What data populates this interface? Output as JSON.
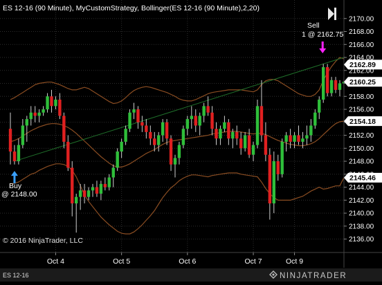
{
  "header": {
    "title": "ES 12-16 (90 Minute), MyCustomStrategy, Bollinger(ES 12-16 (90 Minute),2,20)"
  },
  "copyright": "© 2016 NinjaTrader, LLC",
  "status_bar": {
    "instrument_tab": "ES 12-16",
    "logo_text": "NINJATRADER"
  },
  "annotations": {
    "buy_line1": "Buy",
    "buy_line2": "@ 2148.00",
    "sell_line1": "Sell",
    "sell_line2": "1 @ 2162.75"
  },
  "colors": {
    "background": "#000000",
    "grid": "#2e2e2e",
    "axis_text": "#ffffff",
    "up_candle": "#2fbf3a",
    "down_candle": "#e02020",
    "wick": "#cfcfcf",
    "bollinger_band": "#8b4d22",
    "trendline": "#1f6f2a",
    "buy_arrow": "#3aa0ff",
    "sell_arrow": "#ff22ff",
    "price_label_bg": "#ffffff",
    "price_label_text": "#000000"
  },
  "icons": {
    "scroll_end": "play-to-end-icon"
  },
  "chart_data": {
    "type": "candlestick",
    "x_tick_labels": [
      "Oct 4",
      "Oct 5",
      "Oct 6",
      "Oct 7",
      "Oct 9"
    ],
    "x_tick_bar_index": [
      11,
      27,
      43,
      59,
      69
    ],
    "ylim": [
      2135.0,
      2172.0
    ],
    "y_ticks": [
      2136,
      2138,
      2140,
      2142,
      2144,
      2146,
      2148,
      2150,
      2152,
      2154,
      2156,
      2158,
      2160,
      2162,
      2164,
      2166,
      2168,
      2170
    ],
    "y_tick_labels": [
      "2136.00",
      "2138.00",
      "2140.00",
      "2142.00",
      "2144.00",
      "2146.00",
      "2148.00",
      "2150.00",
      "2152.00",
      "2154.00",
      "2156.00",
      "2158.00",
      "2160.00",
      "2162.00",
      "2164.00",
      "2166.00",
      "2168.00",
      "2170.00"
    ],
    "price_labels": [
      {
        "value": 2162.89,
        "text": "2162.89"
      },
      {
        "value": 2160.25,
        "text": "2160.25"
      },
      {
        "value": 2154.18,
        "text": "2154.18"
      },
      {
        "value": 2145.46,
        "text": "2145.46"
      }
    ],
    "candles": [
      {
        "o": 2153.0,
        "h": 2155.5,
        "l": 2147.5,
        "c": 2149.5
      },
      {
        "o": 2149.5,
        "h": 2150.5,
        "l": 2147.5,
        "c": 2148.0
      },
      {
        "o": 2148.0,
        "h": 2151.5,
        "l": 2147.5,
        "c": 2150.5
      },
      {
        "o": 2150.5,
        "h": 2154.5,
        "l": 2150.0,
        "c": 2153.5
      },
      {
        "o": 2153.5,
        "h": 2155.0,
        "l": 2151.0,
        "c": 2154.5
      },
      {
        "o": 2154.5,
        "h": 2156.5,
        "l": 2153.5,
        "c": 2155.5
      },
      {
        "o": 2155.5,
        "h": 2156.5,
        "l": 2154.0,
        "c": 2155.0
      },
      {
        "o": 2155.0,
        "h": 2156.0,
        "l": 2154.0,
        "c": 2155.5
      },
      {
        "o": 2155.5,
        "h": 2156.5,
        "l": 2155.0,
        "c": 2156.0
      },
      {
        "o": 2156.0,
        "h": 2158.5,
        "l": 2155.5,
        "c": 2158.0
      },
      {
        "o": 2158.0,
        "h": 2159.0,
        "l": 2155.5,
        "c": 2156.5
      },
      {
        "o": 2156.5,
        "h": 2158.0,
        "l": 2156.0,
        "c": 2157.5
      },
      {
        "o": 2157.5,
        "h": 2158.5,
        "l": 2154.5,
        "c": 2155.0
      },
      {
        "o": 2155.0,
        "h": 2155.5,
        "l": 2150.0,
        "c": 2151.0
      },
      {
        "o": 2151.0,
        "h": 2152.0,
        "l": 2146.5,
        "c": 2147.0
      },
      {
        "o": 2147.0,
        "h": 2148.0,
        "l": 2139.5,
        "c": 2141.5
      },
      {
        "o": 2141.5,
        "h": 2143.0,
        "l": 2137.0,
        "c": 2142.5
      },
      {
        "o": 2142.5,
        "h": 2144.5,
        "l": 2140.5,
        "c": 2143.5
      },
      {
        "o": 2143.5,
        "h": 2144.5,
        "l": 2141.5,
        "c": 2142.5
      },
      {
        "o": 2142.5,
        "h": 2144.0,
        "l": 2142.0,
        "c": 2143.5
      },
      {
        "o": 2143.5,
        "h": 2144.5,
        "l": 2142.5,
        "c": 2144.0
      },
      {
        "o": 2144.0,
        "h": 2145.0,
        "l": 2142.5,
        "c": 2143.0
      },
      {
        "o": 2143.0,
        "h": 2145.0,
        "l": 2142.0,
        "c": 2144.5
      },
      {
        "o": 2144.5,
        "h": 2145.5,
        "l": 2143.5,
        "c": 2144.0
      },
      {
        "o": 2144.0,
        "h": 2146.0,
        "l": 2143.5,
        "c": 2145.5
      },
      {
        "o": 2145.5,
        "h": 2147.5,
        "l": 2144.0,
        "c": 2147.0
      },
      {
        "o": 2147.0,
        "h": 2150.0,
        "l": 2146.5,
        "c": 2149.5
      },
      {
        "o": 2149.5,
        "h": 2151.5,
        "l": 2148.5,
        "c": 2151.0
      },
      {
        "o": 2151.0,
        "h": 2153.5,
        "l": 2150.5,
        "c": 2153.0
      },
      {
        "o": 2153.0,
        "h": 2156.0,
        "l": 2152.5,
        "c": 2155.5
      },
      {
        "o": 2155.5,
        "h": 2157.0,
        "l": 2154.5,
        "c": 2156.0
      },
      {
        "o": 2156.0,
        "h": 2156.5,
        "l": 2153.0,
        "c": 2154.0
      },
      {
        "o": 2154.0,
        "h": 2155.0,
        "l": 2152.5,
        "c": 2153.5
      },
      {
        "o": 2153.5,
        "h": 2154.5,
        "l": 2151.5,
        "c": 2152.5
      },
      {
        "o": 2152.5,
        "h": 2153.5,
        "l": 2150.5,
        "c": 2151.5
      },
      {
        "o": 2151.5,
        "h": 2152.5,
        "l": 2149.5,
        "c": 2150.5
      },
      {
        "o": 2150.5,
        "h": 2152.5,
        "l": 2149.5,
        "c": 2152.0
      },
      {
        "o": 2152.0,
        "h": 2154.5,
        "l": 2151.0,
        "c": 2154.0
      },
      {
        "o": 2154.0,
        "h": 2154.5,
        "l": 2150.5,
        "c": 2151.5
      },
      {
        "o": 2151.5,
        "h": 2152.0,
        "l": 2146.5,
        "c": 2147.5
      },
      {
        "o": 2147.5,
        "h": 2149.0,
        "l": 2145.5,
        "c": 2148.5
      },
      {
        "o": 2148.5,
        "h": 2151.0,
        "l": 2147.5,
        "c": 2150.5
      },
      {
        "o": 2150.5,
        "h": 2153.5,
        "l": 2150.0,
        "c": 2153.0
      },
      {
        "o": 2153.0,
        "h": 2155.0,
        "l": 2152.0,
        "c": 2154.5
      },
      {
        "o": 2154.5,
        "h": 2156.5,
        "l": 2153.0,
        "c": 2155.0
      },
      {
        "o": 2155.0,
        "h": 2156.0,
        "l": 2152.5,
        "c": 2153.5
      },
      {
        "o": 2153.5,
        "h": 2155.5,
        "l": 2152.0,
        "c": 2155.0
      },
      {
        "o": 2155.0,
        "h": 2157.0,
        "l": 2154.0,
        "c": 2156.5
      },
      {
        "o": 2156.5,
        "h": 2158.0,
        "l": 2155.0,
        "c": 2155.5
      },
      {
        "o": 2155.5,
        "h": 2156.5,
        "l": 2152.0,
        "c": 2153.0
      },
      {
        "o": 2153.0,
        "h": 2154.0,
        "l": 2150.5,
        "c": 2151.5
      },
      {
        "o": 2151.5,
        "h": 2153.5,
        "l": 2150.5,
        "c": 2153.0
      },
      {
        "o": 2153.0,
        "h": 2155.0,
        "l": 2152.5,
        "c": 2154.0
      },
      {
        "o": 2154.0,
        "h": 2154.5,
        "l": 2150.5,
        "c": 2151.5
      },
      {
        "o": 2151.5,
        "h": 2153.0,
        "l": 2150.0,
        "c": 2152.5
      },
      {
        "o": 2152.5,
        "h": 2153.5,
        "l": 2150.5,
        "c": 2151.5
      },
      {
        "o": 2151.5,
        "h": 2152.5,
        "l": 2149.0,
        "c": 2150.0
      },
      {
        "o": 2150.0,
        "h": 2152.5,
        "l": 2149.5,
        "c": 2152.0
      },
      {
        "o": 2152.0,
        "h": 2153.0,
        "l": 2148.5,
        "c": 2149.0
      },
      {
        "o": 2149.0,
        "h": 2151.0,
        "l": 2148.0,
        "c": 2150.5
      },
      {
        "o": 2150.5,
        "h": 2157.5,
        "l": 2150.0,
        "c": 2156.5
      },
      {
        "o": 2156.5,
        "h": 2160.5,
        "l": 2151.0,
        "c": 2152.0
      },
      {
        "o": 2152.0,
        "h": 2154.0,
        "l": 2148.0,
        "c": 2149.0
      },
      {
        "o": 2149.0,
        "h": 2150.0,
        "l": 2139.0,
        "c": 2141.5
      },
      {
        "o": 2141.5,
        "h": 2149.5,
        "l": 2140.0,
        "c": 2148.0
      },
      {
        "o": 2148.0,
        "h": 2149.0,
        "l": 2145.0,
        "c": 2146.0
      },
      {
        "o": 2146.0,
        "h": 2151.5,
        "l": 2145.5,
        "c": 2151.0
      },
      {
        "o": 2151.0,
        "h": 2152.5,
        "l": 2149.5,
        "c": 2152.0
      },
      {
        "o": 2152.0,
        "h": 2153.0,
        "l": 2150.0,
        "c": 2151.0
      },
      {
        "o": 2151.0,
        "h": 2152.5,
        "l": 2150.0,
        "c": 2152.0
      },
      {
        "o": 2152.0,
        "h": 2153.5,
        "l": 2150.5,
        "c": 2151.0
      },
      {
        "o": 2151.0,
        "h": 2152.5,
        "l": 2150.0,
        "c": 2151.5
      },
      {
        "o": 2151.5,
        "h": 2153.5,
        "l": 2150.5,
        "c": 2152.0
      },
      {
        "o": 2152.0,
        "h": 2154.5,
        "l": 2151.0,
        "c": 2153.5
      },
      {
        "o": 2153.5,
        "h": 2156.0,
        "l": 2153.0,
        "c": 2155.5
      },
      {
        "o": 2155.5,
        "h": 2158.0,
        "l": 2154.5,
        "c": 2157.5
      },
      {
        "o": 2157.5,
        "h": 2163.0,
        "l": 2157.0,
        "c": 2162.5
      },
      {
        "o": 2162.5,
        "h": 2163.0,
        "l": 2158.0,
        "c": 2158.5
      },
      {
        "o": 2158.5,
        "h": 2161.0,
        "l": 2158.0,
        "c": 2160.5
      },
      {
        "o": 2160.5,
        "h": 2161.0,
        "l": 2158.5,
        "c": 2159.0
      },
      {
        "o": 2159.0,
        "h": 2160.5,
        "l": 2158.0,
        "c": 2160.0
      },
      {
        "o": 2160.0,
        "h": 2161.0,
        "l": 2159.0,
        "c": 2160.25
      }
    ],
    "bollinger_upper": [
      2157.5,
      2157.8,
      2158.2,
      2158.6,
      2159.0,
      2159.4,
      2159.8,
      2160.0,
      2160.1,
      2160.2,
      2160.2,
      2160.0,
      2159.8,
      2159.5,
      2159.2,
      2159.0,
      2159.0,
      2159.2,
      2159.4,
      2159.2,
      2158.8,
      2158.4,
      2158.0,
      2157.6,
      2157.2,
      2156.9,
      2157.0,
      2157.3,
      2157.8,
      2158.4,
      2158.9,
      2159.2,
      2159.4,
      2159.5,
      2159.4,
      2159.2,
      2159.0,
      2158.8,
      2158.6,
      2158.3,
      2158.0,
      2157.6,
      2157.4,
      2157.3,
      2157.3,
      2157.5,
      2157.8,
      2158.1,
      2158.4,
      2158.6,
      2158.7,
      2158.8,
      2158.9,
      2159.0,
      2159.0,
      2159.0,
      2159.0,
      2158.9,
      2158.8,
      2158.7,
      2159.0,
      2159.8,
      2160.4,
      2160.6,
      2160.6,
      2160.4,
      2160.0,
      2159.6,
      2159.2,
      2158.8,
      2158.4,
      2158.2,
      2158.0,
      2158.0,
      2158.3,
      2159.0,
      2160.5,
      2161.6,
      2162.6,
      2163.4,
      2164.0,
      2163.8
    ],
    "bollinger_middle": [
      2151.0,
      2151.2,
      2151.5,
      2151.9,
      2152.3,
      2152.7,
      2153.0,
      2153.3,
      2153.5,
      2153.7,
      2153.8,
      2153.8,
      2153.7,
      2153.5,
      2153.2,
      2152.8,
      2152.3,
      2151.7,
      2151.1,
      2150.5,
      2149.9,
      2149.3,
      2148.7,
      2148.2,
      2147.7,
      2147.3,
      2147.1,
      2147.1,
      2147.3,
      2147.6,
      2148.0,
      2148.4,
      2148.8,
      2149.2,
      2149.5,
      2149.8,
      2150.2,
      2150.6,
      2150.9,
      2151.1,
      2151.2,
      2151.3,
      2151.4,
      2151.5,
      2151.6,
      2151.7,
      2151.8,
      2151.9,
      2152.0,
      2152.2,
      2152.3,
      2152.4,
      2152.5,
      2152.6,
      2152.6,
      2152.6,
      2152.5,
      2152.4,
      2152.3,
      2152.2,
      2152.3,
      2152.3,
      2152.1,
      2151.8,
      2151.5,
      2151.2,
      2151.0,
      2150.8,
      2150.6,
      2150.5,
      2150.4,
      2150.4,
      2150.5,
      2150.7,
      2151.0,
      2151.5,
      2152.1,
      2152.7,
      2153.3,
      2153.8,
      2154.1,
      2154.18
    ],
    "bollinger_lower": [
      2144.5,
      2144.6,
      2144.8,
      2145.2,
      2145.6,
      2146.0,
      2146.2,
      2146.6,
      2146.9,
      2147.2,
      2147.4,
      2147.6,
      2147.6,
      2147.5,
      2147.2,
      2146.6,
      2145.6,
      2144.2,
      2142.8,
      2141.8,
      2141.0,
      2140.2,
      2139.4,
      2138.8,
      2138.2,
      2137.7,
      2137.2,
      2136.9,
      2136.8,
      2136.8,
      2137.1,
      2137.6,
      2138.2,
      2138.9,
      2139.6,
      2140.4,
      2141.4,
      2142.4,
      2143.2,
      2143.9,
      2144.4,
      2145.0,
      2145.4,
      2145.7,
      2145.9,
      2145.9,
      2145.8,
      2145.7,
      2145.6,
      2145.8,
      2145.9,
      2146.0,
      2146.1,
      2146.2,
      2146.2,
      2146.2,
      2146.0,
      2145.9,
      2145.8,
      2145.7,
      2145.6,
      2144.8,
      2143.8,
      2143.0,
      2142.4,
      2142.0,
      2142.0,
      2142.0,
      2142.0,
      2142.2,
      2142.4,
      2142.6,
      2143.0,
      2143.4,
      2143.7,
      2144.0,
      2143.7,
      2143.8,
      2144.0,
      2144.2,
      2144.2,
      2145.46
    ],
    "trendline": {
      "from_bar": 1,
      "from_value": 2148.0,
      "to_bar": 81,
      "to_value": 2164.0
    },
    "buy_signal": {
      "bar": 1,
      "value": 2148.0
    },
    "sell_signal": {
      "bar": 76,
      "value": 2162.75
    }
  }
}
